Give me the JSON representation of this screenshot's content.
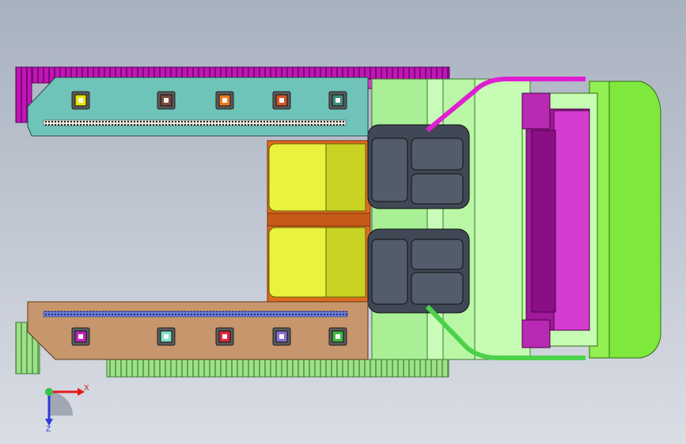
{
  "viewport": {
    "background_top": "#a8b1bf",
    "background_bottom": "#dadde4"
  },
  "colors": {
    "upper_arm": "#6fc4b9",
    "lower_arm": "#c7966c",
    "upper_track": "#c214b8",
    "lower_track": "#9fe08c",
    "chassis": "#b9f7a6",
    "cab": "#7fe83d",
    "seat_frame": "#404855",
    "pad_yellow": "#e9f23c",
    "hub": "#a01a9a",
    "orange_deck": "#e06a1e",
    "pipe_magenta": "#e01fd2",
    "pipe_green": "#4cd24a"
  },
  "markers_upper": [
    {
      "name": "marker-yellow",
      "color": "#e6e600"
    },
    {
      "name": "marker-brown",
      "color": "#7a4a3a"
    },
    {
      "name": "marker-orange",
      "color": "#f07b22"
    },
    {
      "name": "marker-rust",
      "color": "#d4572a"
    },
    {
      "name": "marker-teal",
      "color": "#3b8c7c"
    }
  ],
  "markers_lower": [
    {
      "name": "marker-magenta",
      "color": "#c224c2"
    },
    {
      "name": "marker-mint",
      "color": "#7fe3c4"
    },
    {
      "name": "marker-red",
      "color": "#e0283c"
    },
    {
      "name": "marker-violet",
      "color": "#8b6ed6"
    },
    {
      "name": "marker-green",
      "color": "#3fb83f"
    }
  ],
  "triad": {
    "x_label": "X",
    "z_label": "Z"
  }
}
